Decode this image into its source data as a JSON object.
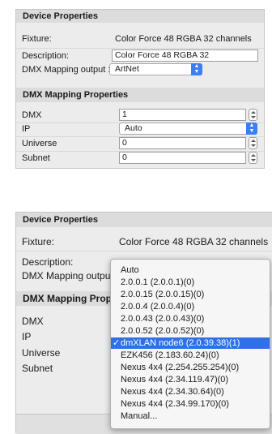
{
  "top": {
    "device_properties_title": "Device Properties",
    "fixture_label": "Fixture:",
    "fixture_value": "Color Force 48 RGBA 32 channels",
    "description_label": "Description:",
    "description_value": "Color Force 48 RGBA 32",
    "dmx_mapping_label": "DMX Mapping output :",
    "dmx_mapping_value": "ArtNet",
    "dmx_mapping_properties_title": "DMX Mapping Properties",
    "dmx_label": "DMX",
    "dmx_value": "1",
    "ip_label": "IP",
    "ip_value": "Auto",
    "universe_label": "Universe",
    "universe_value": "0",
    "subnet_label": "Subnet",
    "subnet_value": "0"
  },
  "bottom": {
    "device_properties_title": "Device Properties",
    "fixture_label": "Fixture:",
    "fixture_value": "Color Force 48 RGBA 32 channels",
    "description_label": "Description:",
    "dmx_mapping_label": "DMX Mapping outpu",
    "dmx_mapping_properties_title": "DMX Mapping Prop",
    "dmx_label": "DMX",
    "ip_label": "IP",
    "universe_label": "Universe",
    "subnet_label": "Subnet"
  },
  "ip_menu": {
    "check_mark": "✓",
    "items": [
      "Auto",
      "2.0.0.1 (2.0.0.1)(0)",
      "2.0.0.15 (2.0.0.15)(0)",
      "2.0.0.4 (2.0.0.4)(0)",
      "2.0.0.43 (2.0.0.43)(0)",
      "2.0.0.52 (2.0.0.52)(0)",
      "dmXLAN node6 (2.0.39.38)(1)",
      "EZK456 (2.183.60.24)(0)",
      "Nexus 4x4 (2.254.255.254)(0)",
      "Nexus 4x4 (2.34.119.47)(0)",
      "Nexus 4x4 (2.34.30.64)(0)",
      "Nexus 4x4 (2.34.99.170)(0)",
      "Manual..."
    ],
    "selected_index": 6
  },
  "colors": {
    "accent": "#2f6fe8",
    "panel": "#ececec",
    "header": "#dcdcdc"
  }
}
